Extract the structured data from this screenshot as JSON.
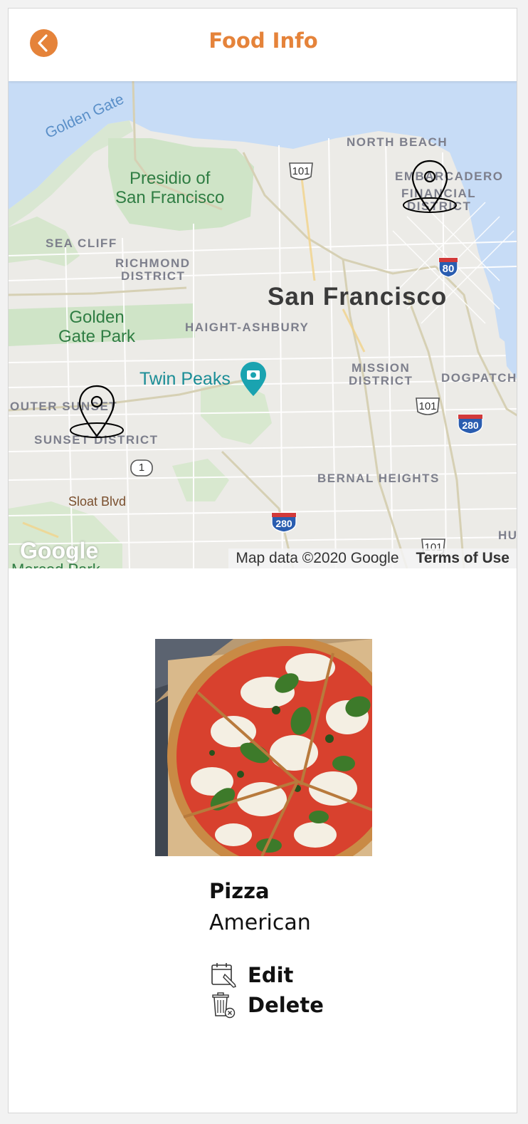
{
  "header": {
    "title": "Food Info",
    "back_icon": "chevron-left-icon",
    "accent_color": "#e5833a"
  },
  "map": {
    "labels": {
      "golden_gate": "Golden Gate",
      "north_beach": "NORTH BEACH",
      "presidio": "Presidio of\nSan Francisco",
      "embarcadero": "EMBARCADERO",
      "financial": "FINANCIAL",
      "district": "DISTRICT",
      "sea_cliff": "SEA CLIFF",
      "richmond": "RICHMOND",
      "richmond_district": "DISTRICT",
      "san_francisco": "San Francisco",
      "golden_gate_park": "Golden\nGate Park",
      "haight": "HAIGHT-ASHBURY",
      "twin_peaks": "Twin Peaks",
      "mission": "MISSION",
      "mission_district": "DISTRICT",
      "dogpatch": "DOGPATCH",
      "outer_sunset": "OUTER SUNSET",
      "sunset_district": "SUNSET DISTRICT",
      "sloat": "Sloat Blvd",
      "bernal": "BERNAL HEIGHTS",
      "merced": "Merced Park",
      "hu": "HU"
    },
    "shields": {
      "us101_north": "101",
      "i80": "80",
      "us101_mission": "101",
      "i280_east": "280",
      "ca1": "1",
      "i280_south": "280",
      "us101_south": "101"
    },
    "markers": [
      "map-pin-icon",
      "map-pin-icon"
    ],
    "google_logo": "Google",
    "credit": "Map data ©2020 Google",
    "terms": "Terms of Use"
  },
  "food": {
    "image_subject": "pizza-photo",
    "name": "Pizza",
    "cuisine": "American"
  },
  "actions": {
    "edit_label": "Edit",
    "edit_icon": "calendar-edit-icon",
    "delete_label": "Delete",
    "delete_icon": "trash-icon"
  }
}
